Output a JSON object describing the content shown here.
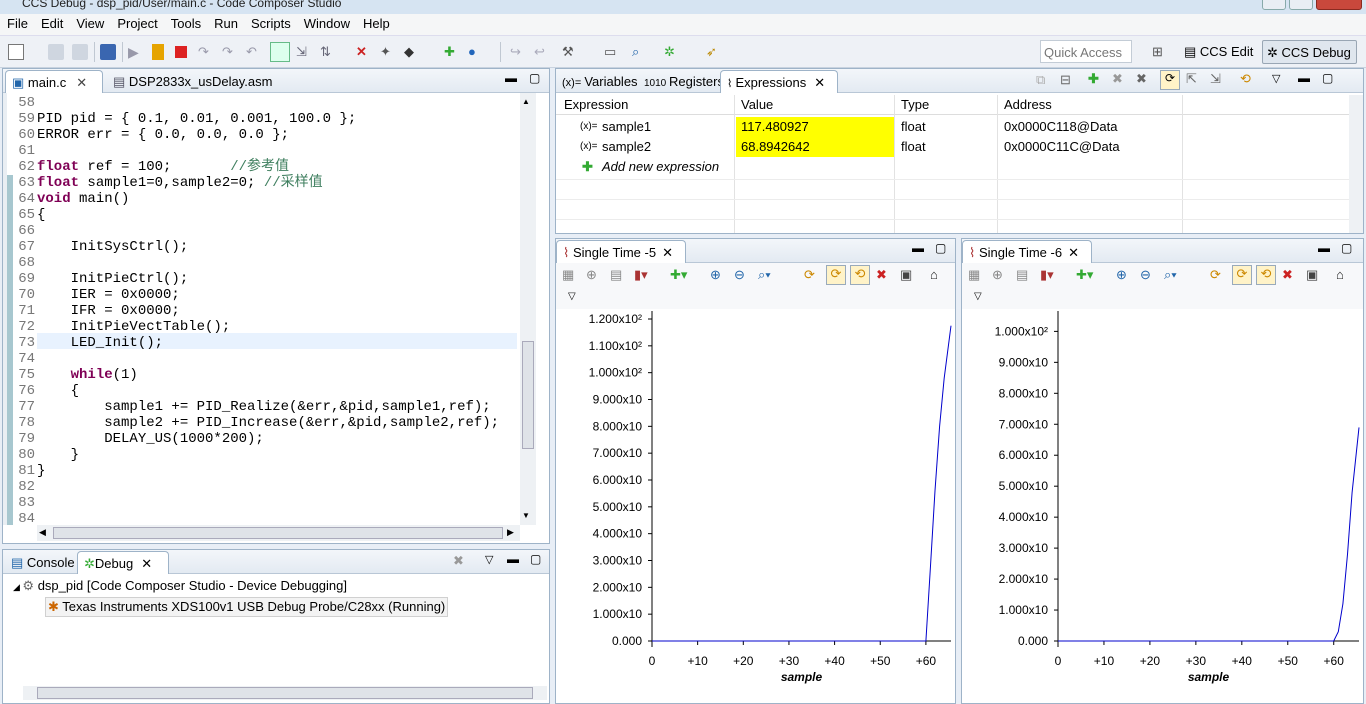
{
  "window": {
    "title": "CCS Debug - dsp_pid/User/main.c - Code Composer Studio"
  },
  "menu": [
    "File",
    "Edit",
    "View",
    "Project",
    "Tools",
    "Run",
    "Scripts",
    "Window",
    "Help"
  ],
  "quick_access": {
    "placeholder": "Quick Access"
  },
  "perspectives": {
    "edit": "CCS Edit",
    "debug": "CCS Debug"
  },
  "editor": {
    "tabs": [
      "main.c",
      "DSP2833x_usDelay.asm"
    ],
    "lines": [
      {
        "n": "58",
        "t": ""
      },
      {
        "n": "59",
        "t": "PID pid = { 0.1, 0.01, 0.001, 100.0 };"
      },
      {
        "n": "60",
        "t": "ERROR err = { 0.0, 0.0, 0.0 };"
      },
      {
        "n": "61",
        "t": ""
      },
      {
        "n": "62",
        "t": "float ref = 100;       //参考值"
      },
      {
        "n": "63",
        "t": "float sample1=0,sample2=0; //采样值"
      },
      {
        "n": "64",
        "t": "void main()"
      },
      {
        "n": "65",
        "t": "{"
      },
      {
        "n": "66",
        "t": ""
      },
      {
        "n": "67",
        "t": "    InitSysCtrl();"
      },
      {
        "n": "68",
        "t": ""
      },
      {
        "n": "69",
        "t": "    InitPieCtrl();"
      },
      {
        "n": "70",
        "t": "    IER = 0x0000;"
      },
      {
        "n": "71",
        "t": "    IFR = 0x0000;"
      },
      {
        "n": "72",
        "t": "    InitPieVectTable();"
      },
      {
        "n": "73",
        "t": "    LED_Init();"
      },
      {
        "n": "74",
        "t": ""
      },
      {
        "n": "75",
        "t": "    while(1)"
      },
      {
        "n": "76",
        "t": "    {"
      },
      {
        "n": "77",
        "t": "        sample1 += PID_Realize(&err,&pid,sample1,ref);"
      },
      {
        "n": "78",
        "t": "        sample2 += PID_Increase(&err,&pid,sample2,ref);"
      },
      {
        "n": "79",
        "t": "        DELAY_US(1000*200);"
      },
      {
        "n": "80",
        "t": "    }"
      },
      {
        "n": "81",
        "t": "}"
      },
      {
        "n": "82",
        "t": ""
      },
      {
        "n": "83",
        "t": ""
      },
      {
        "n": "84",
        "t": ""
      }
    ]
  },
  "expressions_view": {
    "tabs": [
      "Variables",
      "Registers",
      "Expressions"
    ],
    "headers": [
      "Expression",
      "Value",
      "Type",
      "Address"
    ],
    "rows": [
      {
        "name": "sample1",
        "value": "117.480927",
        "type": "float",
        "address": "0x0000C118@Data"
      },
      {
        "name": "sample2",
        "value": "68.8942642",
        "type": "float",
        "address": "0x0000C11C@Data"
      }
    ],
    "add_label": "Add new expression",
    "highlight_color": "#ffff00"
  },
  "debug_view": {
    "tabs": [
      "Console",
      "Debug"
    ],
    "project": "dsp_pid [Code Composer Studio - Device Debugging]",
    "target": "Texas Instruments XDS100v1 USB Debug Probe/C28xx (Running)"
  },
  "chart_data": [
    {
      "type": "line",
      "tab": "Single Time -5",
      "xlabel": "sample",
      "x_ticks": [
        "0",
        "+10",
        "+20",
        "+30",
        "+40",
        "+50",
        "+60"
      ],
      "y_ticks": [
        "0.000",
        "1.000x10",
        "2.000x10",
        "3.000x10",
        "4.000x10",
        "5.000x10",
        "6.000x10",
        "7.000x10",
        "8.000x10",
        "9.000x10",
        "1.000x10²",
        "1.100x10²",
        "1.200x10²"
      ],
      "xlim": [
        0,
        65.5
      ],
      "ylim": [
        0,
        120
      ],
      "x": [
        0,
        60,
        61,
        62,
        63,
        64,
        65.5
      ],
      "y": [
        0,
        0,
        28,
        56,
        80,
        98,
        117.5
      ],
      "color": "#0000cc"
    },
    {
      "type": "line",
      "tab": "Single Time -6",
      "xlabel": "sample",
      "x_ticks": [
        "0",
        "+10",
        "+20",
        "+30",
        "+40",
        "+50",
        "+60"
      ],
      "y_ticks": [
        "0.000",
        "1.000x10",
        "2.000x10",
        "3.000x10",
        "4.000x10",
        "5.000x10",
        "6.000x10",
        "7.000x10",
        "8.000x10",
        "9.000x10",
        "1.000x10²"
      ],
      "xlim": [
        0,
        65.5
      ],
      "ylim": [
        0,
        104
      ],
      "x": [
        0,
        60,
        61,
        62,
        63,
        64,
        65.5
      ],
      "y": [
        0,
        0,
        3,
        12,
        28,
        48,
        69
      ],
      "color": "#0000cc"
    }
  ]
}
